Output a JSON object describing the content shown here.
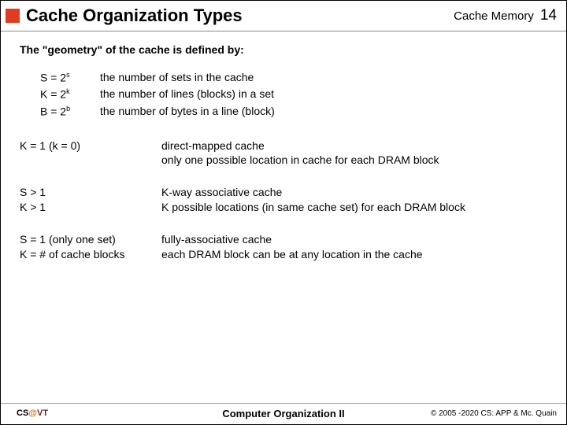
{
  "header": {
    "title": "Cache Organization Types",
    "section": "Cache Memory",
    "page": "14"
  },
  "intro": "The \"geometry\" of the cache is defined by:",
  "geom": [
    {
      "lhs_base": "S = 2",
      "lhs_sup": "s",
      "desc": "the number of sets in the cache"
    },
    {
      "lhs_base": "K = 2",
      "lhs_sup": "k",
      "desc": "the number of lines (blocks) in a set"
    },
    {
      "lhs_base": "B = 2",
      "lhs_sup": "b",
      "desc": "the number of bytes in a line (block)"
    }
  ],
  "types": [
    {
      "left_lines": [
        "K = 1 (k = 0)",
        ""
      ],
      "right_lines": [
        "direct-mapped cache",
        "only one possible location in cache for each DRAM block"
      ]
    },
    {
      "left_lines": [
        "S > 1",
        "K > 1",
        ""
      ],
      "right_lines": [
        "",
        "K-way associative cache",
        "K possible locations (in same cache set) for each DRAM block"
      ]
    },
    {
      "left_lines": [
        "S = 1 (only one set)",
        "K = # of cache blocks"
      ],
      "right_lines": [
        "fully-associative cache",
        "each DRAM block can be at any location in the cache"
      ]
    }
  ],
  "footer": {
    "left_cs": "CS",
    "left_at": "@",
    "left_vt": "VT",
    "center": "Computer Organization II",
    "right": "© 2005 -2020 CS: APP & Mc. Quain"
  }
}
